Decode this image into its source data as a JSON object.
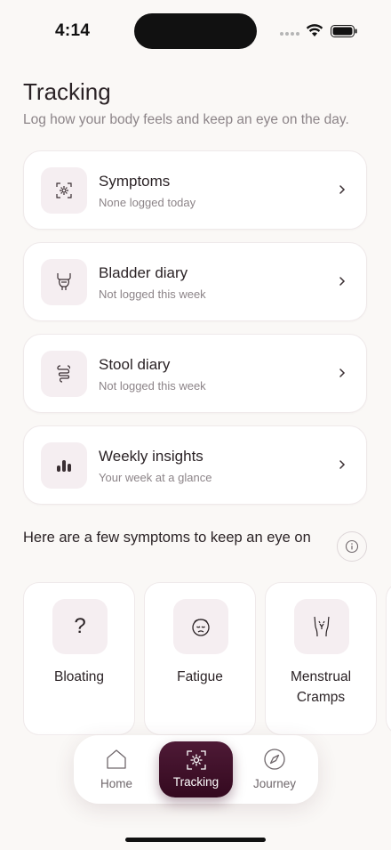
{
  "status_bar": {
    "time": "4:14"
  },
  "header": {
    "title": "Tracking",
    "subtitle": "Log how your body feels and keep an eye on the day."
  },
  "tracking_items": [
    {
      "title": "Symptoms",
      "subtitle": "None logged today",
      "icon": "symptoms-scan-icon"
    },
    {
      "title": "Bladder diary",
      "subtitle": "Not logged this week",
      "icon": "bladder-icon"
    },
    {
      "title": "Stool diary",
      "subtitle": "Not logged this week",
      "icon": "intestine-icon"
    },
    {
      "title": "Weekly insights",
      "subtitle": "Your week at a glance",
      "icon": "bar-chart-icon"
    }
  ],
  "symptoms_section": {
    "title": "Here are a few symptoms to keep an eye on",
    "items": [
      {
        "label": "Bloating",
        "icon": "question-icon"
      },
      {
        "label": "Fatigue",
        "icon": "tired-face-icon"
      },
      {
        "label": "Menstrual Cramps",
        "icon": "pelvis-icon"
      }
    ]
  },
  "bottom_nav": {
    "home": "Home",
    "tracking": "Tracking",
    "journey": "Journey",
    "active": "tracking"
  },
  "colors": {
    "background": "#faf8f6",
    "accent": "#3d0f28",
    "icon_tile": "#f5eef1",
    "muted_text": "#8c8488"
  }
}
